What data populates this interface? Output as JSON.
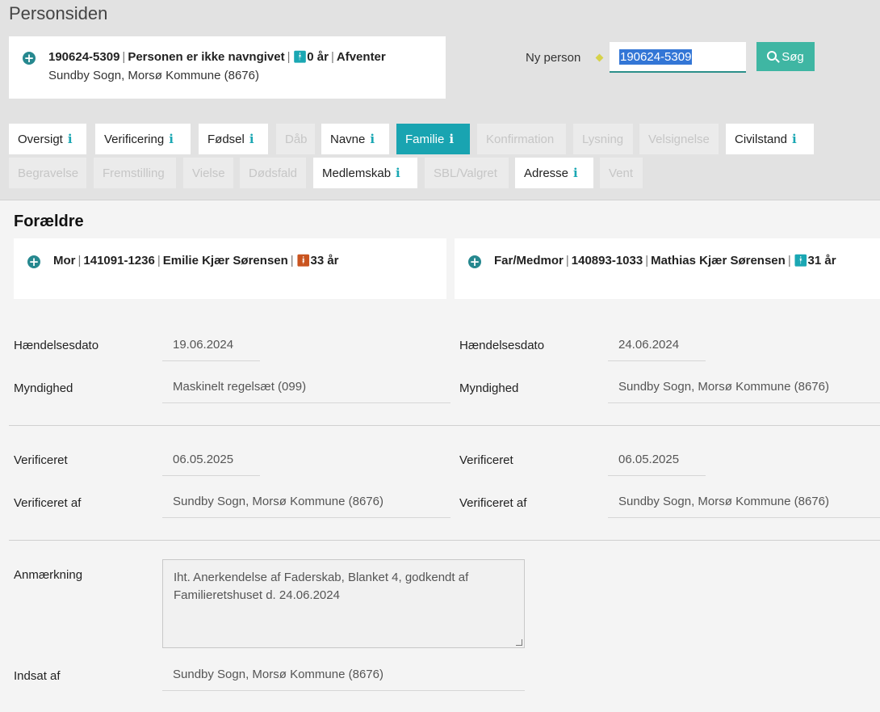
{
  "page": {
    "title": "Personsiden"
  },
  "person": {
    "cpr": "190624-5309",
    "name": "Personen er ikke navngivet",
    "age": "0 år",
    "status": "Afventer",
    "parish": "Sundby Sogn, Morsø Kommune (8676)"
  },
  "search": {
    "label": "Ny person",
    "value": "190624-5309",
    "button_label": "Søg"
  },
  "tabs": [
    {
      "label": "Oversigt",
      "info": true,
      "state": "normal"
    },
    {
      "label": "Verificering",
      "info": true,
      "state": "normal"
    },
    {
      "label": "Fødsel",
      "info": true,
      "state": "normal"
    },
    {
      "label": "Dåb",
      "info": false,
      "state": "disabled"
    },
    {
      "label": "Navne",
      "info": true,
      "state": "normal"
    },
    {
      "label": "Familie",
      "info": true,
      "state": "active"
    },
    {
      "label": "Konfirmation",
      "info": false,
      "state": "disabled"
    },
    {
      "label": "Lysning",
      "info": false,
      "state": "disabled"
    },
    {
      "label": "Velsignelse",
      "info": false,
      "state": "disabled"
    },
    {
      "label": "Civilstand",
      "info": true,
      "state": "normal"
    },
    {
      "label": "Begravelse",
      "info": false,
      "state": "disabled"
    },
    {
      "label": "Fremstilling",
      "info": false,
      "state": "disabled"
    },
    {
      "label": "Vielse",
      "info": false,
      "state": "disabled"
    },
    {
      "label": "Dødsfald",
      "info": false,
      "state": "disabled"
    },
    {
      "label": "Medlemskab",
      "info": true,
      "state": "normal"
    },
    {
      "label": "SBL/Valgret",
      "info": false,
      "state": "disabled"
    },
    {
      "label": "Adresse",
      "info": true,
      "state": "normal"
    },
    {
      "label": "Vent",
      "info": false,
      "state": "disabled"
    }
  ],
  "info_glyph": "i",
  "parents": {
    "title": "Forældre",
    "mother": {
      "role": "Mor",
      "cpr": "141091-1236",
      "name": "Emilie Kjær Sørensen",
      "age": "33 år"
    },
    "father": {
      "role": "Far/Medmor",
      "cpr": "140893-1033",
      "name": "Mathias Kjær Sørensen",
      "age": "31 år"
    }
  },
  "labels": {
    "event_date": "Hændelsesdato",
    "authority": "Myndighed",
    "verified": "Verificeret",
    "verified_by": "Verificeret af",
    "remark": "Anmærkning",
    "inserted_by": "Indsat af"
  },
  "mother_fields": {
    "event_date": "19.06.2024",
    "authority": "Maskinelt regelsæt (099)",
    "verified": "06.05.2025",
    "verified_by": "Sundby Sogn, Morsø Kommune (8676)"
  },
  "father_fields": {
    "event_date": "24.06.2024",
    "authority": "Sundby Sogn, Morsø Kommune (8676)",
    "verified": "06.05.2025",
    "verified_by": "Sundby Sogn, Morsø Kommune (8676)"
  },
  "remark": {
    "text": "Iht. Anerkendelse af Faderskab, Blanket 4, godkendt af Familieretshuset d. 24.06.2024",
    "inserted_by": "Sundby Sogn, Morsø Kommune (8676)"
  },
  "icons": {
    "plus": "plus-circle-icon",
    "info": "info-icon",
    "male": "male-person-icon",
    "female": "female-person-icon",
    "search": "search-icon"
  },
  "colors": {
    "accent": "#19a4b1",
    "button": "#3fb6a3",
    "female": "#c9541f",
    "selection": "#3376d6"
  }
}
